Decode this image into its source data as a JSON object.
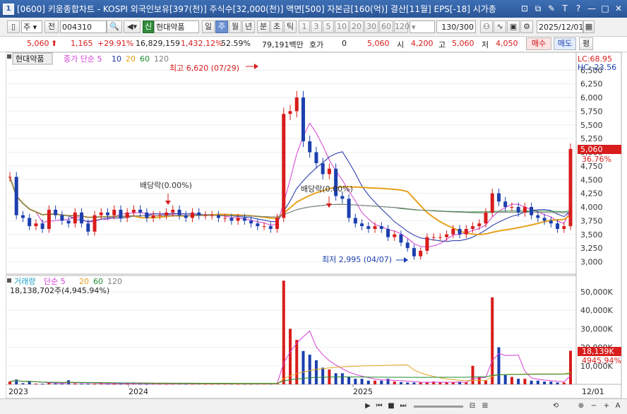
{
  "window": {
    "title": "[0600] 키움종합차트 - KOSPI 외국인보유[397(천)] 주식수[32,000(천)] 액면[500] 자본금[160(억)] 결산[11월] EPS[-18] 시가총",
    "app_icon": "1",
    "buttons": [
      "⊡",
      "⧉",
      "✎",
      "T",
      "?",
      "—",
      "□",
      "✕"
    ]
  },
  "toolbar": {
    "market_select": "주",
    "period_prefix": "전",
    "stock_code": "004310",
    "stock_badge": "신",
    "stock_name": "현대약품",
    "period_buttons": [
      "일",
      "주",
      "월",
      "년",
      "분",
      "초",
      "틱"
    ],
    "selected_period": "주",
    "interval_buttons": [
      "1",
      "3",
      "5",
      "10",
      "20",
      "30",
      "60",
      "120"
    ],
    "count": "130",
    "count_total": "/300",
    "date": "2025/12/01"
  },
  "quote": {
    "price": "5,060",
    "change": "1,165",
    "change_pct": "+29.91%",
    "volume": "16,829,159",
    "volume_pct": "1,432.12%",
    "ratio": "52.59%",
    "amount": "79,191백만",
    "hoga_label": "호가",
    "hoga": "0",
    "hoga_price": "5,060",
    "open_label": "시",
    "open": "4,200",
    "high_label": "고",
    "high": "5,060",
    "low_label": "저",
    "low": "4,050",
    "buy_label": "매수",
    "sell_label": "매도",
    "flat_label": "평"
  },
  "price_panel": {
    "stock_tag": "현대약품",
    "ma_label": "종가 단순 5",
    "ma_periods": [
      "10",
      "20",
      "60",
      "120"
    ],
    "ma_colors": [
      "#d43fd4",
      "#1e2fa8",
      "#e6a21c",
      "#1e8a2e",
      "#7d7d7d"
    ],
    "lc": "LC:68.95",
    "hc": "HC:-23.56",
    "high_marker": "최고 6,620 (07/29)",
    "low_marker": "최저 2,995 (04/07)",
    "dividend1": "배당락(0.00%)",
    "dividend2": "배당락(0.00%)",
    "current_price_tag": "5,060",
    "current_pct_tag": "36.76%"
  },
  "volume_panel": {
    "label": "거래량",
    "ma_label": "단순 5",
    "ma_periods": [
      "20",
      "60",
      "120"
    ],
    "info": "18,138,702주(4,945.94%)",
    "current_tag": "18,139K",
    "current_pct_tag": "4945.94%"
  },
  "x_axis": [
    "2023",
    "2024",
    "2025",
    "12/01"
  ],
  "bottom_buttons": [
    "▶",
    "⏮",
    "■",
    "⏭",
    "⊟",
    "⊞",
    "⟲",
    "⊕",
    "−",
    "+",
    "A"
  ],
  "chart_data": {
    "type": "candlestick",
    "price_axis": {
      "ticks": [
        3000,
        3250,
        3500,
        3750,
        4000,
        4250,
        4500,
        4750,
        5000,
        5250,
        5500,
        5750,
        6000,
        6250,
        6500
      ],
      "ylim": [
        2800,
        6800
      ]
    },
    "volume_axis": {
      "ticks": [
        "10,000K",
        "20,000K",
        "30,000K",
        "40,000K",
        "50,000K"
      ],
      "ylim": [
        0,
        58000
      ]
    },
    "series": [
      {
        "name": "종가",
        "values": [
          4550,
          3850,
          3800,
          3650,
          3700,
          3600,
          3950,
          3850,
          3750,
          3700,
          3900,
          3700,
          3550,
          3850,
          3900,
          3850,
          3950,
          3800,
          3900,
          3950,
          3900,
          3800,
          3850,
          3850,
          3900,
          3950,
          3850,
          3800,
          3900,
          3850,
          3850,
          3850,
          3800,
          3800,
          3750,
          3800,
          3750,
          3700,
          3650,
          3650,
          3600,
          3800,
          5700,
          5750,
          6000,
          5200,
          5000,
          4800,
          4600,
          4700,
          4200,
          4150,
          3800,
          3700,
          3650,
          3600,
          3650,
          3600,
          3450,
          3500,
          3350,
          3250,
          3100,
          3200,
          3450,
          3450,
          3450,
          3500,
          3600,
          3500,
          3600,
          3650,
          3700,
          3900,
          4250,
          4100,
          4000,
          4000,
          3900,
          4000,
          3850,
          3800,
          3750,
          3700,
          3600,
          3650,
          5060
        ]
      },
      {
        "name": "거래량",
        "values": [
          1500,
          2600,
          600,
          1800,
          400,
          300,
          900,
          500,
          300,
          2200,
          500,
          350,
          300,
          300,
          700,
          300,
          250,
          300,
          300,
          500,
          300,
          250,
          400,
          300,
          250,
          300,
          300,
          250,
          300,
          300,
          250,
          250,
          300,
          300,
          250,
          250,
          250,
          250,
          300,
          300,
          300,
          600,
          56000,
          30000,
          24000,
          18000,
          16000,
          13000,
          9000,
          8000,
          6000,
          6000,
          4000,
          3000,
          3000,
          2000,
          2000,
          2000,
          3000,
          1500,
          1200,
          1000,
          1000,
          1000,
          1200,
          1500,
          1000,
          1000,
          1000,
          1500,
          1000,
          10000,
          4000,
          2000,
          47000,
          20000,
          5000,
          4000,
          3000,
          3000,
          2000,
          2000,
          1500,
          1500,
          1000,
          1000,
          18139
        ]
      }
    ]
  }
}
